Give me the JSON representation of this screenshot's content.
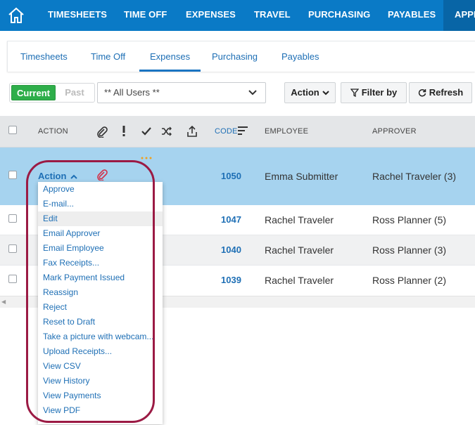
{
  "topnav": {
    "items": [
      "TIMESHEETS",
      "TIME OFF",
      "EXPENSES",
      "TRAVEL",
      "PURCHASING",
      "PAYABLES",
      "APPR"
    ],
    "active_index": 6,
    "color": "#0a7ac6"
  },
  "subtabs": {
    "items": [
      "Timesheets",
      "Time Off",
      "Expenses",
      "Purchasing",
      "Payables"
    ],
    "active_index": 2
  },
  "toolbar": {
    "current_label": "Current",
    "past_label": "Past",
    "users_value": "** All Users **",
    "action_label": "Action",
    "filter_label": "Filter by",
    "refresh_label": "Refresh"
  },
  "table": {
    "headers": {
      "action": "ACTION",
      "code": "CODE",
      "employee": "EMPLOYEE",
      "approver": "APPROVER"
    },
    "rows": [
      {
        "action": "Action",
        "code": "1050",
        "employee": "Emma Submitter",
        "approver": "Rachel Traveler (3)",
        "selected": true
      },
      {
        "code": "1047",
        "employee": "Rachel Traveler",
        "approver": "Ross Planner (5)"
      },
      {
        "code": "1040",
        "employee": "Rachel Traveler",
        "approver": "Ross Planner (3)"
      },
      {
        "code": "1039",
        "employee": "Rachel Traveler",
        "approver": "Ross Planner (2)"
      }
    ]
  },
  "action_menu": {
    "items": [
      "Approve",
      "E-mail...",
      "Edit",
      "Email Approver",
      "Email Employee",
      "Fax Receipts...",
      "Mark Payment Issued",
      "Reassign",
      "Reject",
      "Reset to Draft",
      "Take a picture with webcam...",
      "Upload Receipts...",
      "View CSV",
      "View History",
      "View Payments",
      "View PDF"
    ],
    "hover_index": 2
  },
  "colors": {
    "accent": "#1e6fb5",
    "selected_row": "#a6d3ef",
    "current_toggle": "#2eae4a",
    "highlight_ring": "#9b1a44"
  }
}
